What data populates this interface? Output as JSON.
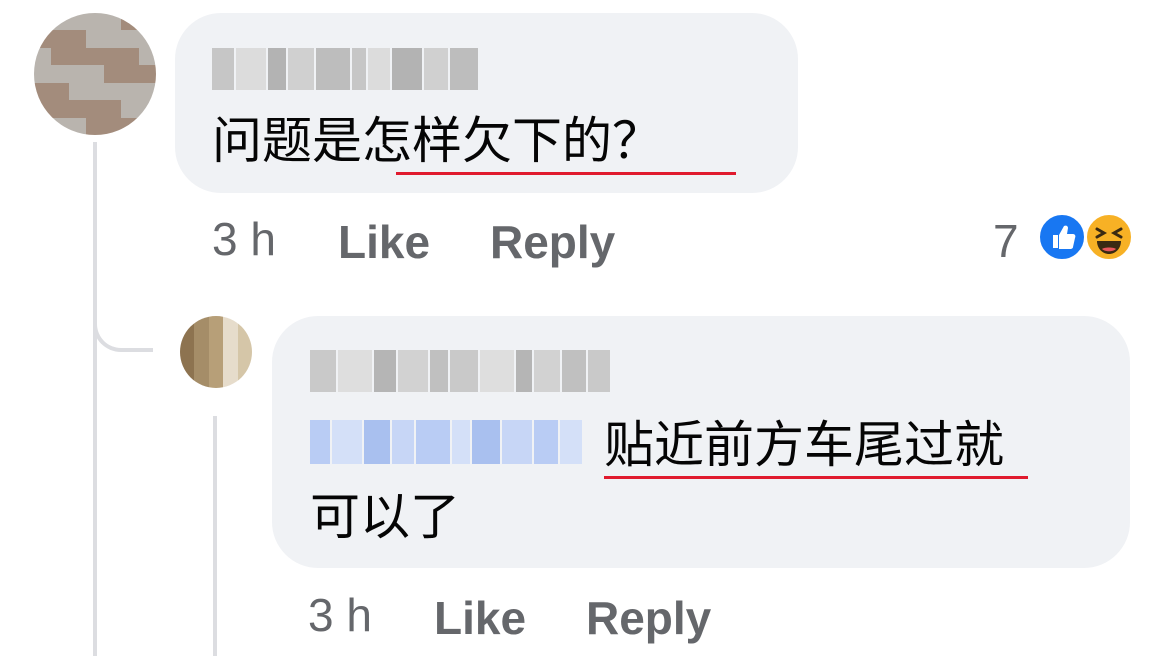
{
  "comments": [
    {
      "text": "问题是怎样欠下的？",
      "time": "3 h",
      "like_label": "Like",
      "reply_label": "Reply",
      "reaction_count": "7",
      "reactions": [
        "like-icon",
        "haha-icon"
      ]
    },
    {
      "text_line1": "贴近前方车尾过就",
      "text_line2": "可以了",
      "time": "3 h",
      "like_label": "Like",
      "reply_label": "Reply"
    }
  ],
  "colors": {
    "bubble_bg": "#f0f2f5",
    "text": "#050505",
    "meta": "#65676b",
    "underline": "#e01a2e",
    "like_blue": "#1877f2",
    "haha_yellow": "#f7b125",
    "mention_blue": "#b9ccf4"
  }
}
